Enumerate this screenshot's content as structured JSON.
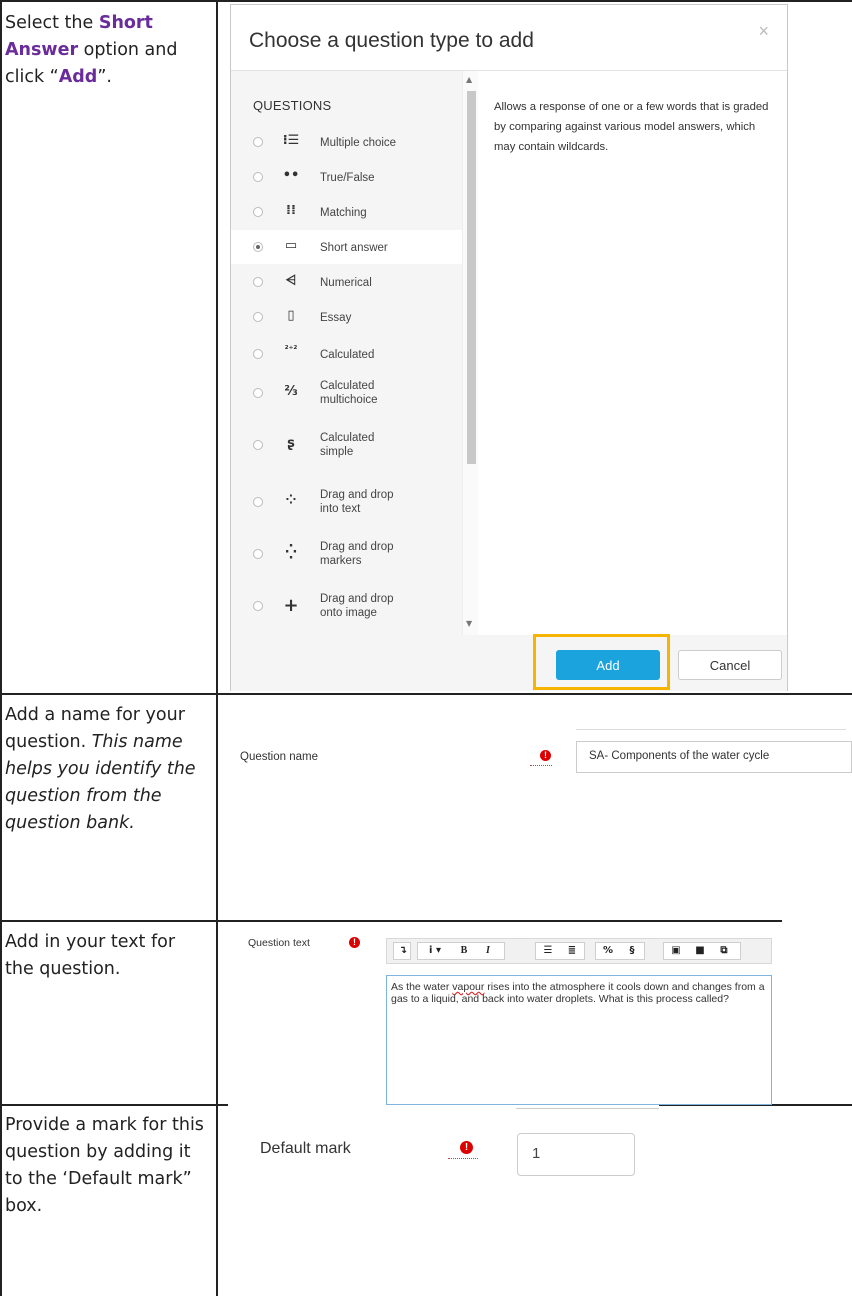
{
  "rows": [
    {
      "instruction_parts": [
        {
          "t": "Select the "
        },
        {
          "t": "Short Answer",
          "hl": true
        },
        {
          "t": " option and click “"
        },
        {
          "t": "Add",
          "hl": true
        },
        {
          "t": "”."
        }
      ]
    },
    {
      "instruction_plain": "Add a name for your question. ",
      "instruction_italic": "This name helps you identify the question from the question bank."
    },
    {
      "instruction": "Add in your text for the question."
    },
    {
      "instruction": "Provide a mark for this question by adding it to the ‘Default mark” box."
    }
  ],
  "modal": {
    "title": "Choose a question type to add",
    "close": "×",
    "questions_header": "QUESTIONS",
    "questions": [
      {
        "icon": "multiple-choice-icon",
        "glyph": "⁝☰",
        "label": "Multiple choice",
        "selected": false
      },
      {
        "icon": "true-false-icon",
        "glyph": "••",
        "label": "True/False",
        "selected": false
      },
      {
        "icon": "matching-icon",
        "glyph": "⁞⁞",
        "label": "Matching",
        "selected": false
      },
      {
        "icon": "short-answer-icon",
        "glyph": "▭",
        "label": "Short answer",
        "selected": true
      },
      {
        "icon": "numerical-icon",
        "glyph": "⩤",
        "label": "Numerical",
        "selected": false
      },
      {
        "icon": "essay-icon",
        "glyph": "▯",
        "label": "Essay",
        "selected": false
      },
      {
        "icon": "calculated-icon",
        "glyph": "²⁺²",
        "label": "Calculated",
        "selected": false
      },
      {
        "icon": "calculated-multichoice-icon",
        "glyph": "⅔",
        "label_1": "Calculated",
        "label_2": "multichoice",
        "selected": false
      },
      {
        "icon": "calculated-simple-icon",
        "glyph": "ʂ",
        "label_1": "Calculated",
        "label_2": "simple",
        "selected": false
      },
      {
        "icon": "drag-drop-text-icon",
        "glyph": "⁘",
        "label_1": "Drag and drop",
        "label_2": "into text",
        "selected": false
      },
      {
        "icon": "drag-drop-markers-icon",
        "glyph": "⁛",
        "label_1": "Drag and drop",
        "label_2": "markers",
        "selected": false
      },
      {
        "icon": "drag-drop-image-icon",
        "glyph": "+",
        "label_1": "Drag and drop",
        "label_2": "onto image",
        "selected": false
      }
    ],
    "description": "Allows a response of one or a few words that is graded by comparing against various model answers, which may contain wildcards.",
    "add_label": "Add",
    "cancel_label": "Cancel",
    "highlight_color": "#f4b400",
    "add_color": "#1aa3dc"
  },
  "question_name": {
    "label": "Question name",
    "value": "SA- Components of the water cycle"
  },
  "question_text": {
    "label": "Question text",
    "text_before": "As the water ",
    "text_misspelled": "vapour",
    "text_after": " rises into the atmosphere it cools down and changes from a gas to a liquid, and back into water droplets. What is this process called?"
  },
  "default_mark": {
    "label": "Default mark",
    "value": "1"
  },
  "required_icon": "!",
  "required_color": "#d00000"
}
